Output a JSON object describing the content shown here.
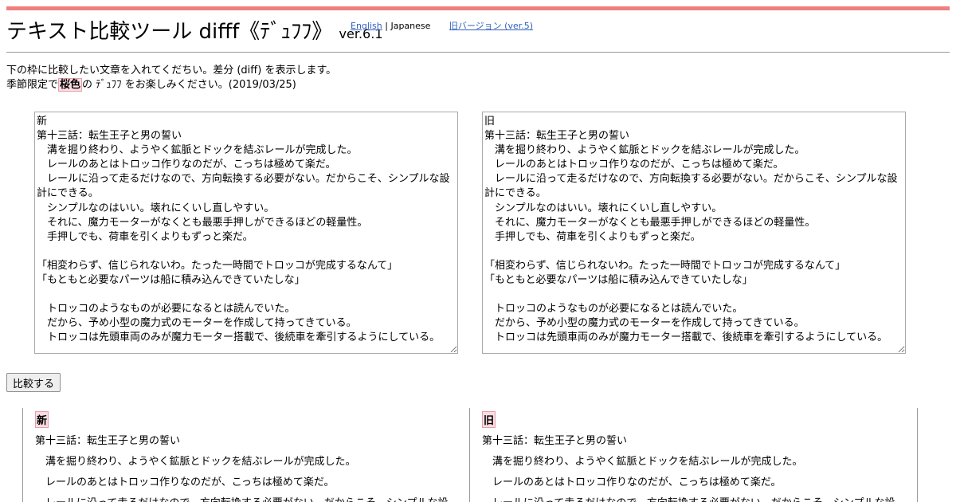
{
  "app": {
    "title": "テキスト比較ツール difff《ﾃﾞｭﾌﾌ》",
    "version": "ver.6.1"
  },
  "lang": {
    "english": "English",
    "separator": "|",
    "japanese": "Japanese",
    "old_version": "旧バージョン (ver.5)"
  },
  "intro": {
    "line1": "下の枠に比較したい文章を入れてくだちい。差分 (diff) を表示します。",
    "line2_pre": "季節限定で",
    "line2_highlight": "桜色",
    "line2_post": "の ﾃﾞｭﾌﾌ をお楽しみください。(2019/03/25)"
  },
  "colors": {
    "accent_bar": "#f08080",
    "highlight_bg": "#fadde1",
    "highlight_border": "#e3a0ac",
    "link": "#2f5fbf"
  },
  "inputs": {
    "new_text": "新\n第十三話：転生王子と男の誓い\n　溝を掘り終わり、ようやく鉱脈とドックを結ぶレールが完成した。\n　レールのあとはトロッコ作りなのだが、こっちは極めて楽だ。\n　レールに沿って走るだけなので、方向転換する必要がない。だからこそ、シンプルな設計にできる。\n　シンプルなのはいい。壊れにくいし直しやすい。\n　それに、魔力モーターがなくとも最悪手押しができるほどの軽量性。\n　手押しでも、荷車を引くよりもずっと楽だ。\n\n「相変わらず、信じられないわ。たった一時間でトロッコが完成するなんて」\n「もともと必要なパーツは船に積み込んできていたしな」\n\n　トロッコのようなものが必要になるとは読んでいた。\n　だから、予め小型の魔力式のモーターを作成して持ってきている。\n　トロッコは先頭車両のみが魔力モーター搭載で、後続車を牽引するようにしている。\n\n「さて、行こうか」",
    "old_text": "旧\n第十三話：転生王子と男の誓い\n　溝を掘り終わり、ようやく鉱脈とドックを結ぶレールが完成した。\n　レールのあとはトロッコ作りなのだが、こっちは極めて楽だ。\n　レールに沿って走るだけなので、方向転換する必要がない。だからこそ、シンプルな設計にできる。\n　シンプルなのはいい。壊れにくいし直しやすい。\n　それに、魔力モーターがなくとも最悪手押しができるほどの軽量性。\n　手押しでも、荷車を引くよりもずっと楽だ。\n\n「相変わらず、信じられないわ。たった一時間でトロッコが完成するなんて」\n「もともと必要なパーツは船に積み込んできていたしな」\n\n　トロッコのようなものが必要になるとは読んでいた。\n　だから、予め小型の魔力式のモーターを作成して持ってきている。\n　トロッコは先頭車両のみが魔力モーター搭載で、後続車を牽引するようにしている。\n\n「さて、行こうか」"
  },
  "compare_button": "比較する",
  "result": {
    "new": {
      "header": "新",
      "lines": [
        "第十三話：転生王子と男の誓い",
        "　溝を掘り終わり、ようやく鉱脈とドックを結ぶレールが完成した。",
        "　レールのあとはトロッコ作りなのだが、こっちは極めて楽だ。",
        "　レールに沿って走るだけなので、方向転換する必要がない。だからこそ、シンプルな設"
      ]
    },
    "old": {
      "header": "旧",
      "lines": [
        "第十三話：転生王子と男の誓い",
        "　溝を掘り終わり、ようやく鉱脈とドックを結ぶレールが完成した。",
        "　レールのあとはトロッコ作りなのだが、こっちは極めて楽だ。",
        "　レールに沿って走るだけなので、方向転換する必要がない。だからこそ、シンプルな設"
      ]
    }
  }
}
